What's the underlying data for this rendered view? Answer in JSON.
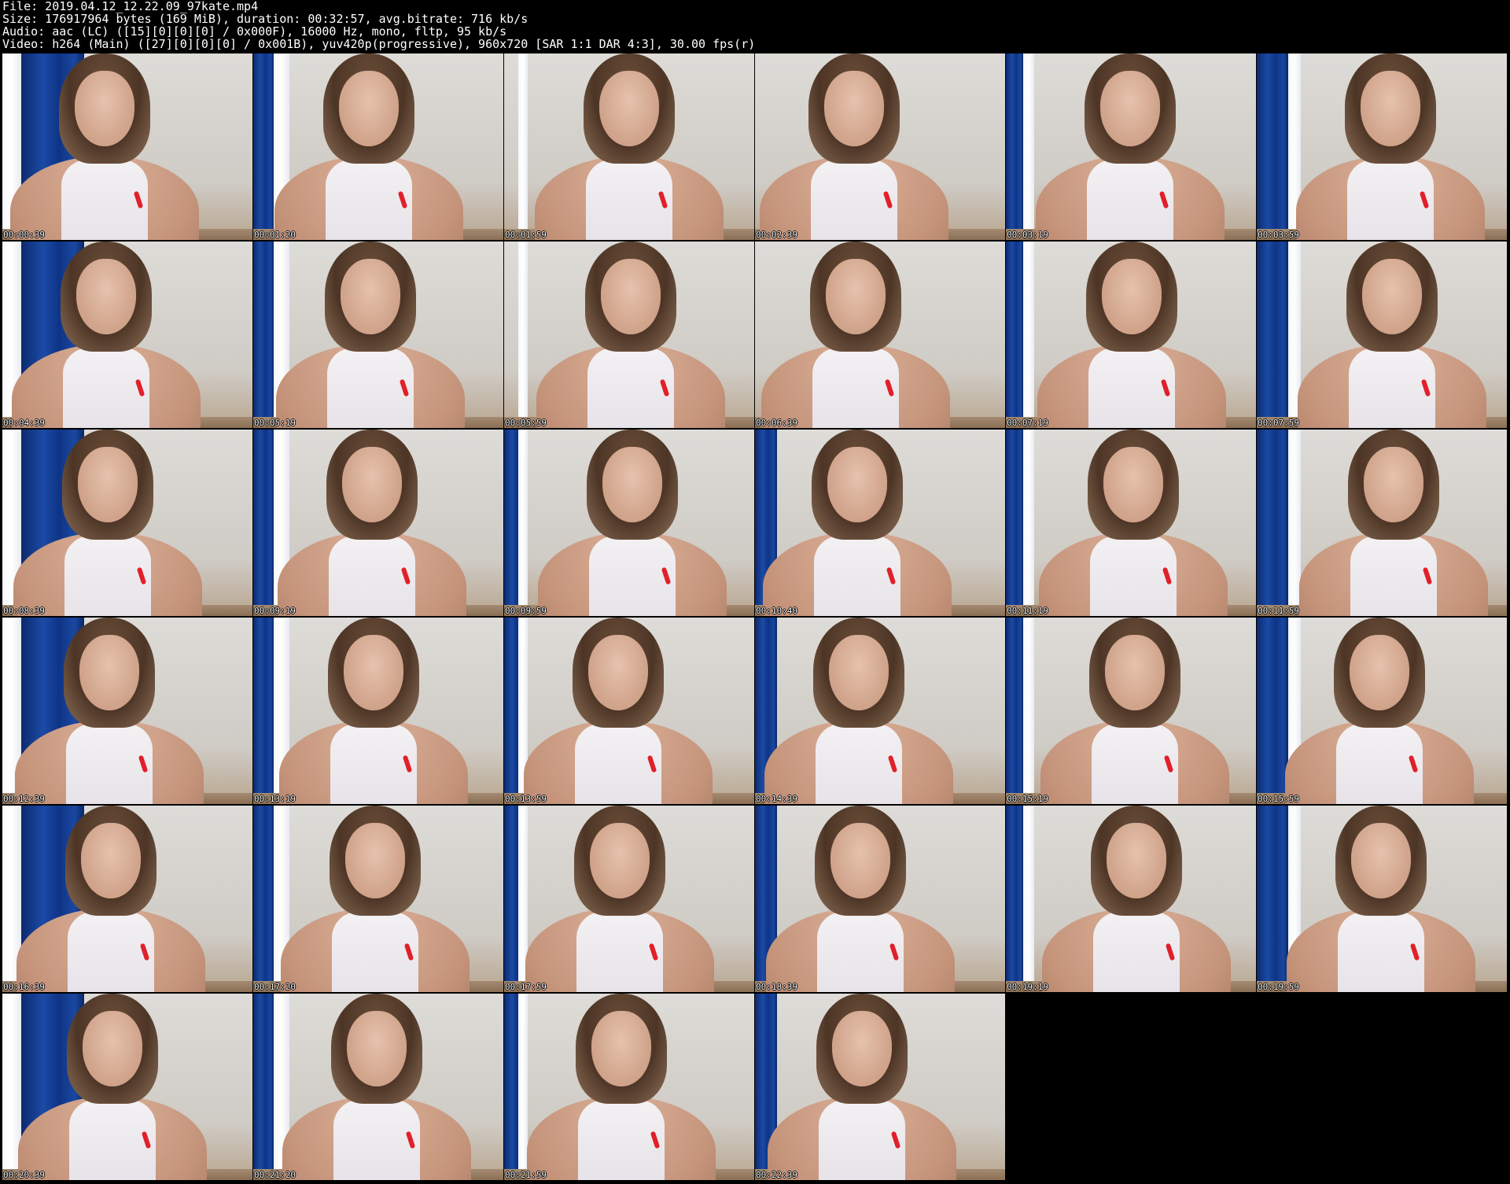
{
  "header": {
    "file_line": "File: 2019.04.12_12.22.09_97kate.mp4",
    "size_line": "Size: 176917964 bytes (169 MiB), duration: 00:32:57, avg.bitrate: 716 kb/s",
    "audio_line": "Audio: aac (LC) ([15][0][0][0] / 0x000F), 16000 Hz, mono, fltp, 95 kb/s",
    "video_line": "Video: h264 (Main) ([27][0][0][0] / 0x001B), yuv420p(progressive), 960x720 [SAR 1:1 DAR 4:3], 30.00 fps(r)"
  },
  "thumbnails": [
    {
      "time": "00:00:39"
    },
    {
      "time": "00:01:20"
    },
    {
      "time": "00:01:59"
    },
    {
      "time": "00:02:39"
    },
    {
      "time": "00:03:19"
    },
    {
      "time": "00:03:59"
    },
    {
      "time": "00:04:39"
    },
    {
      "time": "00:05:19"
    },
    {
      "time": "00:05:59"
    },
    {
      "time": "00:06:39"
    },
    {
      "time": "00:07:19"
    },
    {
      "time": "00:07:59"
    },
    {
      "time": "00:08:39"
    },
    {
      "time": "00:09:19"
    },
    {
      "time": "00:09:59"
    },
    {
      "time": "00:10:40"
    },
    {
      "time": "00:11:19"
    },
    {
      "time": "00:11:59"
    },
    {
      "time": "00:12:39"
    },
    {
      "time": "00:13:19"
    },
    {
      "time": "00:13:59"
    },
    {
      "time": "00:14:39"
    },
    {
      "time": "00:15:19"
    },
    {
      "time": "00:15:59"
    },
    {
      "time": "00:16:39"
    },
    {
      "time": "00:17:20"
    },
    {
      "time": "00:17:59"
    },
    {
      "time": "00:18:39"
    },
    {
      "time": "00:19:19"
    },
    {
      "time": "00:19:59"
    },
    {
      "time": "00:20:39"
    },
    {
      "time": "00:21:20"
    },
    {
      "time": "00:21:59"
    },
    {
      "time": "00:22:39"
    }
  ],
  "colors": {
    "background": "#000000",
    "header_text": "#ffffff",
    "curtain": "#1b4aa5",
    "wall": "#dedcd8",
    "ribbon": "#e0202a"
  }
}
